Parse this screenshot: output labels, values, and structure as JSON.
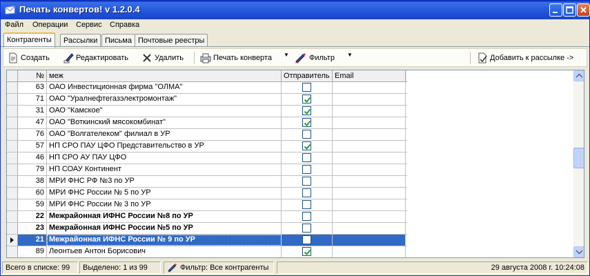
{
  "window": {
    "title": "Печать конвертов! v 1.2.0.4"
  },
  "menu": [
    "Файл",
    "Операции",
    "Сервис",
    "Справка"
  ],
  "tabs": [
    "Контрагенты",
    "Рассылки",
    "Письма",
    "Почтовые реестры"
  ],
  "active_tab": "Контрагенты",
  "toolbar": {
    "create": "Создать",
    "edit": "Редактировать",
    "delete": "Удалить",
    "print": "Печать конверта",
    "filter": "Фильтр",
    "add_to_mailing": "Добавить к рассылке ->"
  },
  "grid": {
    "columns": {
      "num": "№",
      "name": "меж",
      "sender": "Отправитель",
      "email": "Email"
    },
    "rows": [
      {
        "num": "63",
        "name": "ОАО Инвестиционная фирма \"ОЛМА\"",
        "sender": false,
        "bold": false,
        "selected": false
      },
      {
        "num": "71",
        "name": "ОАО \"Уралнефтегазэлектромонтаж\"",
        "sender": true,
        "bold": false,
        "selected": false
      },
      {
        "num": "31",
        "name": "ОАО \"Камское\"",
        "sender": true,
        "bold": false,
        "selected": false
      },
      {
        "num": "47",
        "name": "ОАО \"Воткинский мясокомбинат\"",
        "sender": true,
        "bold": false,
        "selected": false
      },
      {
        "num": "76",
        "name": "ОАО \"Волгателеком\" филиал в УР",
        "sender": false,
        "bold": false,
        "selected": false
      },
      {
        "num": "57",
        "name": "НП СРО ПАУ ЦФО Представительство в УР",
        "sender": true,
        "bold": false,
        "selected": false
      },
      {
        "num": "46",
        "name": "НП СРО АУ ПАУ ЦФО",
        "sender": false,
        "bold": false,
        "selected": false
      },
      {
        "num": "79",
        "name": "НП СОАУ Континент",
        "sender": false,
        "bold": false,
        "selected": false
      },
      {
        "num": "38",
        "name": "МРИ ФНС РФ №3 по УР",
        "sender": false,
        "bold": false,
        "selected": false
      },
      {
        "num": "60",
        "name": "МРИ ФНС России № 5 по УР",
        "sender": false,
        "bold": false,
        "selected": false
      },
      {
        "num": "59",
        "name": "МРИ ФНС России № 3 по УР",
        "sender": false,
        "bold": false,
        "selected": false
      },
      {
        "num": "22",
        "name": "Межрайонная ИФНС России №8 по УР",
        "sender": false,
        "bold": true,
        "selected": false
      },
      {
        "num": "23",
        "name": "Межрайонная ИФНС России №5 по УР",
        "sender": false,
        "bold": true,
        "selected": false
      },
      {
        "num": "21",
        "name": "Межрайонная ИФНС России № 9 по УР",
        "sender": false,
        "bold": true,
        "selected": true
      },
      {
        "num": "89",
        "name": "Леонтьев Антон Борисович",
        "sender": true,
        "bold": false,
        "selected": false
      }
    ]
  },
  "status": {
    "total": "Всего в списке: 99",
    "selected": "Выделено: 1 из 99",
    "filter": "Фильтр: Все контрагенты",
    "datetime": "29 августа 2008 г. 10:24:08"
  },
  "colors": {
    "selection": "#316ac5",
    "titlebar": "#1f4fd6",
    "check": "#21a121"
  }
}
